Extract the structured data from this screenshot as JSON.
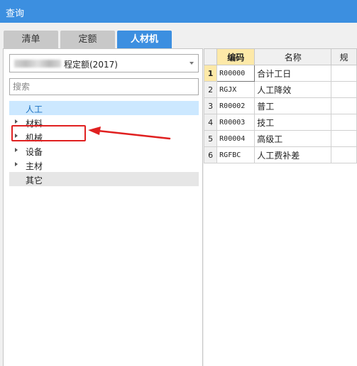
{
  "window": {
    "title": "查询"
  },
  "tabs": [
    {
      "label": "清单",
      "active": false
    },
    {
      "label": "定额",
      "active": false
    },
    {
      "label": "人材机",
      "active": true
    }
  ],
  "left": {
    "dropdown": {
      "selected": "程定额(2017)"
    },
    "search": {
      "placeholder": "搜索"
    },
    "tree": [
      {
        "label": "人工",
        "expandable": false,
        "state": "selected"
      },
      {
        "label": "材料",
        "expandable": true,
        "state": "normal"
      },
      {
        "label": "机械",
        "expandable": true,
        "state": "normal",
        "highlighted": true
      },
      {
        "label": "设备",
        "expandable": true,
        "state": "normal"
      },
      {
        "label": "主材",
        "expandable": true,
        "state": "normal"
      },
      {
        "label": "其它",
        "expandable": false,
        "state": "plain"
      }
    ]
  },
  "grid": {
    "columns": {
      "code": "编码",
      "name": "名称",
      "spec": "规"
    },
    "rows": [
      {
        "no": "1",
        "code": "R00000",
        "name": "合计工日"
      },
      {
        "no": "2",
        "code": "RGJX",
        "name": "人工降效"
      },
      {
        "no": "3",
        "code": "R00002",
        "name": "普工"
      },
      {
        "no": "4",
        "code": "R00003",
        "name": "技工"
      },
      {
        "no": "5",
        "code": "R00004",
        "name": "高级工"
      },
      {
        "no": "6",
        "code": "RGFBC",
        "name": "人工费补差"
      }
    ]
  },
  "annotation": {
    "color": "#e02020"
  }
}
